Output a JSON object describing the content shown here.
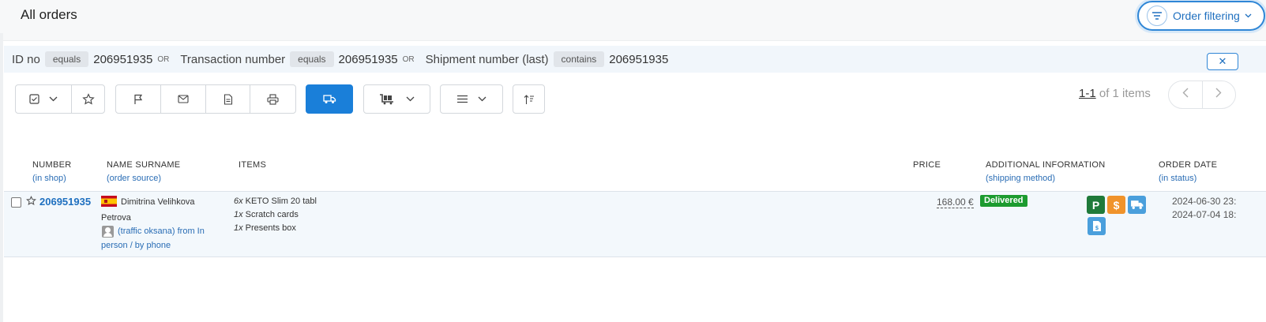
{
  "header": {
    "title": "All orders",
    "order_filtering_label": "Order filtering"
  },
  "filter": {
    "field1": "ID no",
    "op1": "equals",
    "value1": "206951935",
    "or1": "OR",
    "field2": "Transaction number",
    "op2": "equals",
    "value2": "206951935",
    "or2": "OR",
    "field3": "Shipment number (last)",
    "op3": "contains",
    "value3": "206951935",
    "close_label": "✕"
  },
  "pagination": {
    "range": "1-1",
    "of_text": " of 1 items"
  },
  "columns": {
    "number": "NUMBER",
    "number_sub": "(in shop)",
    "name": "NAME SURNAME",
    "name_sub": "(order source)",
    "items": "ITEMS",
    "price": "PRICE",
    "additional": "ADDITIONAL INFORMATION",
    "additional_sub": "(shipping method)",
    "order_date": "ORDER DATE",
    "order_date_sub": "(in status)"
  },
  "order": {
    "number": "206951935",
    "name_line1": "Dimitrina Velihkova",
    "name_line2": "Petrova",
    "source_line1": "(traffic oksana) from In",
    "source_line2": "person / by phone",
    "items": [
      {
        "qty": "6x",
        "name": " KETO Slim 20 tabl"
      },
      {
        "qty": "1x",
        "name": " Scratch cards"
      },
      {
        "qty": "1x",
        "name": " Presents box"
      }
    ],
    "price": "168.00 €",
    "status": "Delivered",
    "icon_p": "P",
    "icon_dollar": "$",
    "date1": "2024-06-30 23:",
    "date2": "2024-07-04 18:"
  },
  "colors": {
    "accent": "#1a7fd9",
    "status_green": "#1c9b2f",
    "icon_p": "#1f7a3a",
    "icon_dollar": "#f0932b",
    "icon_blue": "#4a9fdc"
  }
}
